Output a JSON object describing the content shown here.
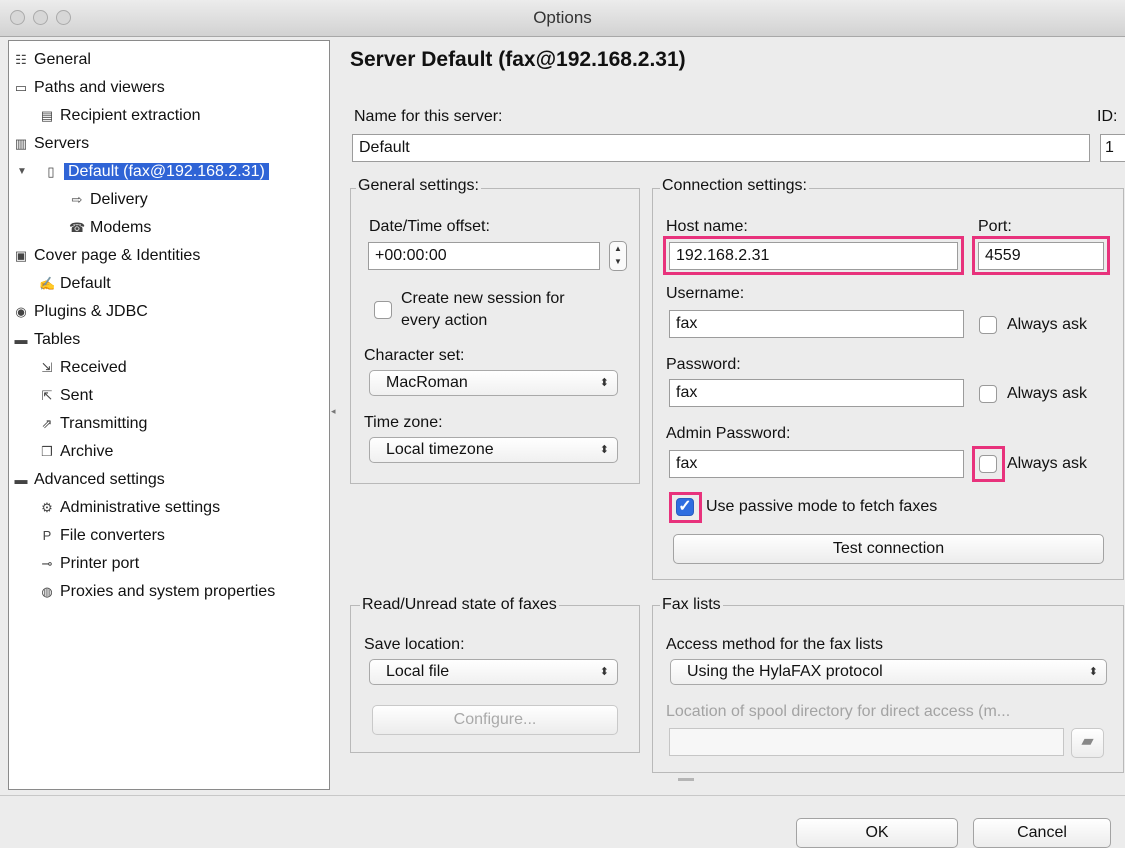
{
  "window": {
    "title": "Options"
  },
  "tree": [
    {
      "label": "General",
      "icon": "general-icon",
      "glyph": "☷"
    },
    {
      "label": "Paths and viewers",
      "icon": "computer-icon",
      "glyph": "▭"
    },
    {
      "label": "Recipient extraction",
      "icon": "document-icon",
      "glyph": "▤"
    },
    {
      "label": "Servers",
      "icon": "servers-icon",
      "glyph": "▥"
    },
    {
      "label": "Default (fax@192.168.2.31)",
      "icon": "server-icon",
      "glyph": "▯"
    },
    {
      "label": "Delivery",
      "icon": "delivery-icon",
      "glyph": "⇨"
    },
    {
      "label": "Modems",
      "icon": "modem-icon",
      "glyph": "☎"
    },
    {
      "label": "Cover page & Identities",
      "icon": "cover-page-icon",
      "glyph": "▣"
    },
    {
      "label": "Default",
      "icon": "signature-icon",
      "glyph": "✍"
    },
    {
      "label": "Plugins & JDBC",
      "icon": "plugins-icon",
      "glyph": "◉"
    },
    {
      "label": "Tables",
      "icon": "folder-icon",
      "glyph": "▬"
    },
    {
      "label": "Received",
      "icon": "received-icon",
      "glyph": "⇲"
    },
    {
      "label": "Sent",
      "icon": "sent-icon",
      "glyph": "⇱"
    },
    {
      "label": "Transmitting",
      "icon": "transmitting-icon",
      "glyph": "⇗"
    },
    {
      "label": "Archive",
      "icon": "archive-icon",
      "glyph": "❒"
    },
    {
      "label": "Advanced settings",
      "icon": "folder-icon",
      "glyph": "▬"
    },
    {
      "label": "Administrative settings",
      "icon": "gears-icon",
      "glyph": "⚙"
    },
    {
      "label": "File converters",
      "icon": "pdf-ps-icon",
      "glyph": "P"
    },
    {
      "label": "Printer port",
      "icon": "plug-icon",
      "glyph": "⊸"
    },
    {
      "label": "Proxies and system properties",
      "icon": "globe-icon",
      "glyph": "◍"
    }
  ],
  "main": {
    "heading": "Server Default (fax@192.168.2.31)",
    "name_label": "Name for this server:",
    "name_value": "Default",
    "id_label": "ID:",
    "id_value": "1",
    "general": {
      "legend": "General settings:",
      "offset_label": "Date/Time offset:",
      "offset_value": "+00:00:00",
      "session_label_1": "Create new session for",
      "session_label_2": "every action",
      "session_checked": false,
      "charset_label": "Character set:",
      "charset_value": "MacRoman",
      "timezone_label": "Time zone:",
      "timezone_value": "Local timezone"
    },
    "connection": {
      "legend": "Connection settings:",
      "host_label": "Host name:",
      "host_value": "192.168.2.31",
      "port_label": "Port:",
      "port_value": "4559",
      "username_label": "Username:",
      "username_value": "fax",
      "password_label": "Password:",
      "password_value": "fax",
      "admin_label": "Admin Password:",
      "admin_value": "fax",
      "always_ask": "Always ask",
      "passive_label": "Use passive mode to fetch faxes",
      "passive_checked": true,
      "test_button": "Test connection"
    },
    "readunread": {
      "legend": "Read/Unread state of faxes",
      "save_label": "Save location:",
      "save_value": "Local file",
      "configure_button": "Configure..."
    },
    "faxlists": {
      "legend": "Fax lists",
      "access_label": "Access method for the fax lists",
      "access_value": "Using the HylaFAX protocol",
      "spool_label": "Location of spool directory for direct access (m...",
      "spool_value": ""
    }
  },
  "footer": {
    "ok": "OK",
    "cancel": "Cancel"
  },
  "colors": {
    "highlight": "#e8327c",
    "selection": "#2f64d6"
  }
}
